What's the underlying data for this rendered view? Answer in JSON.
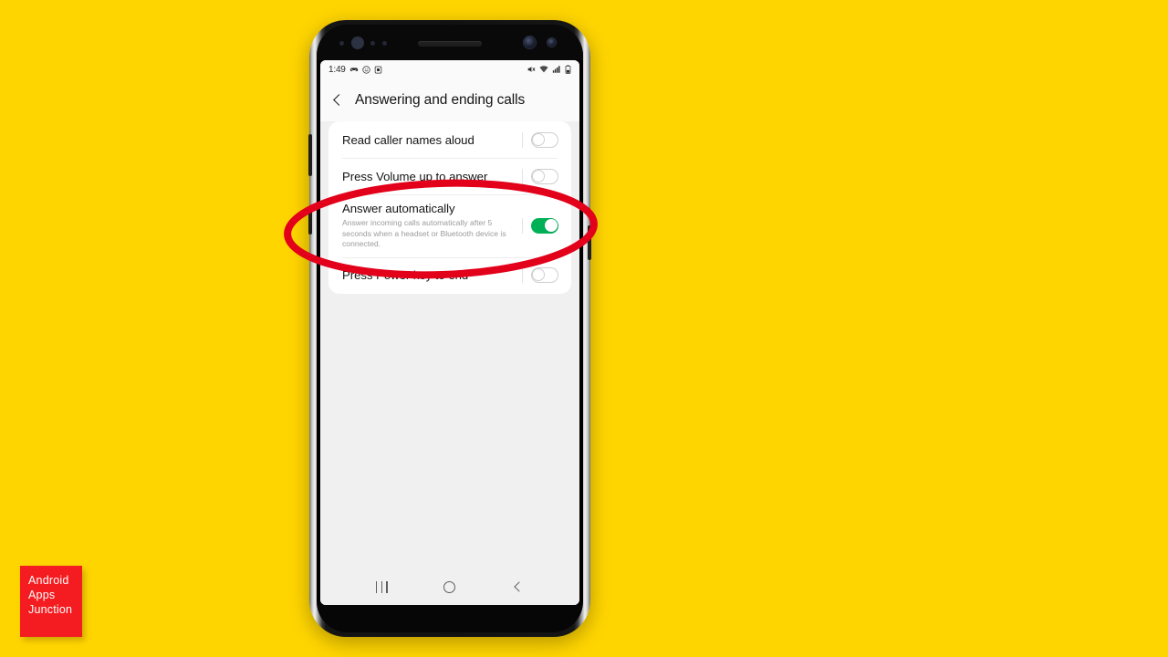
{
  "background": {
    "color": "#FFD500"
  },
  "device": {
    "name": "samsung-galaxy-note-phone",
    "frame_color": "#111111"
  },
  "statusbar": {
    "time": "1:49",
    "left_icons": [
      "game-controller-icon",
      "smiley-face-icon",
      "sim-card-icon"
    ],
    "right_icons": [
      "mute-icon",
      "wifi-icon",
      "signal-bars-icon",
      "battery-icon"
    ]
  },
  "appbar": {
    "back_icon": "back-chevron-icon",
    "title": "Answering and ending calls"
  },
  "settings": {
    "rows": [
      {
        "title": "Read caller names aloud",
        "desc": "",
        "toggle": "off"
      },
      {
        "title": "Press Volume up to answer",
        "desc": "",
        "toggle": "off"
      },
      {
        "title": "Answer automatically",
        "desc": "Answer incoming calls automatically after 5 seconds when a headset or Bluetooth device is connected.",
        "toggle": "on"
      },
      {
        "title": "Press Power key to end",
        "desc": "",
        "toggle": "off"
      }
    ],
    "toggle_on_color": "#00b057",
    "toggle_off_color": "#cfcfcf"
  },
  "navbar": {
    "recents_label": "recents-icon",
    "home_label": "home-icon",
    "back_label": "back-icon"
  },
  "annotation": {
    "shape": "ellipse",
    "color": "#E2001A",
    "stroke_width": 8,
    "target_row": "Answer automatically"
  },
  "watermark": {
    "line1": "Android",
    "line2": "Apps",
    "line3": "Junction",
    "bg_color": "#f41c20",
    "text_color": "#ffffff"
  }
}
